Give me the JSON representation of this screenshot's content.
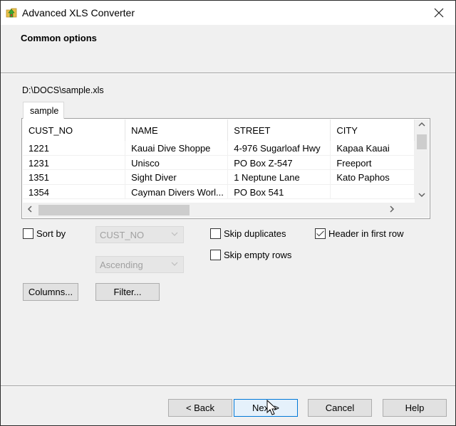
{
  "window": {
    "title": "Advanced XLS Converter",
    "close_icon": "close-icon",
    "app_icon": "folder-arrow-icon"
  },
  "header": {
    "title": "Common options"
  },
  "file": {
    "path": "D:\\DOCS\\sample.xls"
  },
  "sheet_tab": {
    "label": "sample"
  },
  "grid": {
    "columns": [
      "CUST_NO",
      "NAME",
      "STREET",
      "CITY"
    ],
    "rows": [
      [
        "1221",
        "Kauai Dive Shoppe",
        "4-976 Sugarloaf Hwy",
        "Kapaa Kauai"
      ],
      [
        "1231",
        "Unisco",
        "PO Box Z-547",
        "Freeport"
      ],
      [
        "1351",
        "Sight Diver",
        "1 Neptune Lane",
        "Kato Paphos"
      ],
      [
        "1354",
        "Cayman Divers Worl...",
        "PO Box 541",
        ""
      ]
    ]
  },
  "options": {
    "sort_by": {
      "label": "Sort by",
      "checked": false
    },
    "sort_field": {
      "value": "CUST_NO",
      "enabled": false
    },
    "sort_order": {
      "value": "Ascending",
      "enabled": false
    },
    "skip_duplicates": {
      "label": "Skip duplicates",
      "checked": false
    },
    "skip_empty_rows": {
      "label": "Skip empty rows",
      "checked": false
    },
    "header_in_first_row": {
      "label": "Header in first row",
      "checked": true
    }
  },
  "buttons": {
    "columns": "Columns...",
    "filter": "Filter...",
    "back": "< Back",
    "next": "Next >",
    "cancel": "Cancel",
    "help": "Help"
  },
  "colors": {
    "accent": "#0078d7",
    "dialog_bg": "#f0f0f0",
    "titlebar_bg": "#ffffff"
  }
}
